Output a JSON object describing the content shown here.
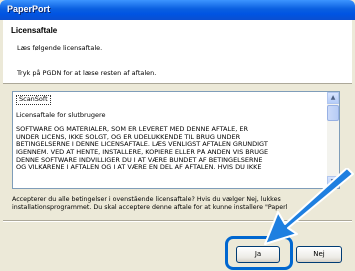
{
  "window": {
    "title": "PaperPort"
  },
  "header": {
    "section_title": "Licensaftale",
    "subtitle": "Læs følgende licensaftale.",
    "instruction": "Tryk på PGDN for at læse resten af aftalen."
  },
  "license": {
    "company": "ScanSoft",
    "heading": "Licensaftale for slutbrugere",
    "lines": [
      "SOFTWARE OG MATERIALER, SOM ER LEVERET MED DENNE AFTALE, ER",
      "UNDER LICENS, IKKE SOLGT, OG ER UDELUKKENDE TIL BRUG UNDER",
      "BETINGELSERNE I DENNE LICENSAFTALE. LÆS VENLIGST AFTALEN GRUNDIGT",
      "IGENNEM. VED AT HENTE, INSTALLERE, KOPIERE ELLER PÅ ANDEN VIS BRUGE",
      "DENNE SOFTWARE INDVILLIGER DU I AT VÆRE BUNDET AF BETINGELSERNE",
      "OG VILKÅRENE I AFTALEN OG I AT VÆRE EN DEL AF AFTALEN.  HVIS DU IKKE"
    ]
  },
  "accept": {
    "line1": "Accepterer du alle betingelser i ovenstående licensaftale? Hvis du vælger Nej, lukkes",
    "line2": "installationsprogrammet. Du skal acceptere denne aftale for at kunne installere \"Paperl"
  },
  "buttons": {
    "yes": "Ja",
    "no": "Nej"
  },
  "icons": {
    "scroll_up": "scroll-up-arrow-icon",
    "scroll_down": "scroll-down-arrow-icon",
    "pointer": "pointer-arrow-icon"
  },
  "colors": {
    "titlebar": "#0054e3",
    "highlight": "#0067d0",
    "arrow": "#1e7fe0"
  }
}
